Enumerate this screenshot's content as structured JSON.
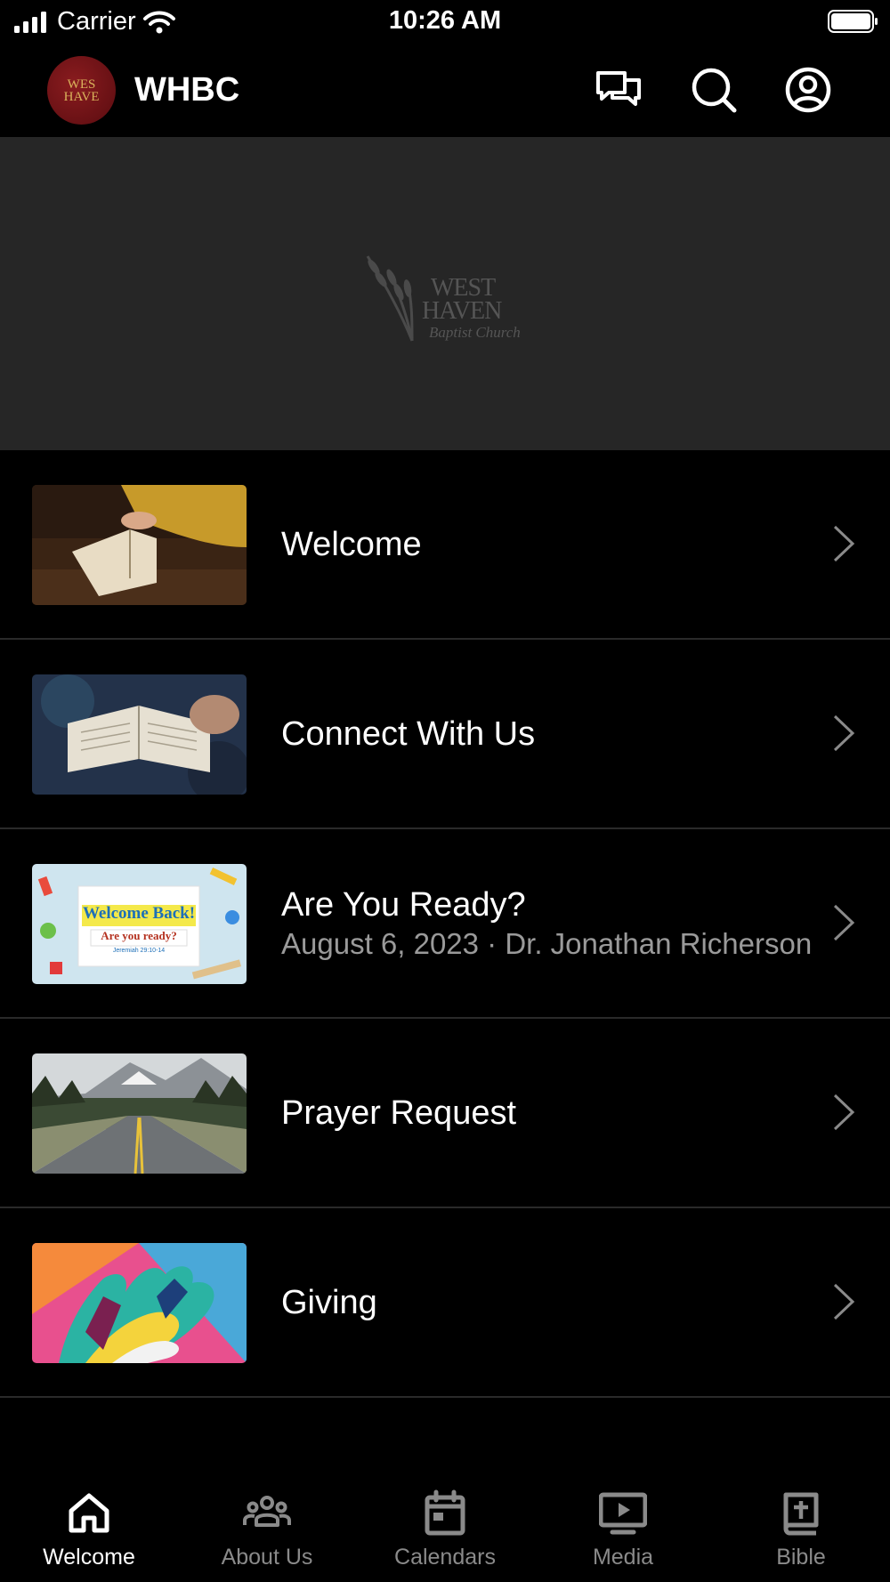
{
  "status_bar": {
    "carrier": "Carrier",
    "time": "10:26 AM"
  },
  "header": {
    "app_title": "WHBC",
    "logo_text": "WES\nHAVE"
  },
  "hero": {
    "logo_line1": "WEST",
    "logo_line2": "HAVEN",
    "logo_line3": "Baptist Church"
  },
  "items": [
    {
      "title": "Welcome",
      "subtitle": ""
    },
    {
      "title": "Connect With Us",
      "subtitle": ""
    },
    {
      "title": "Are You Ready?",
      "subtitle": "August 6, 2023 · Dr. Jonathan Richerson",
      "thumb_title": "Welcome Back!",
      "thumb_sub": "Are you ready?",
      "thumb_ref": "Jeremiah 29:10-14"
    },
    {
      "title": "Prayer Request",
      "subtitle": ""
    },
    {
      "title": "Giving",
      "subtitle": ""
    }
  ],
  "tabs": [
    {
      "label": "Welcome",
      "icon": "home-icon",
      "active": true
    },
    {
      "label": "About Us",
      "icon": "people-icon",
      "active": false
    },
    {
      "label": "Calendars",
      "icon": "calendar-icon",
      "active": false
    },
    {
      "label": "Media",
      "icon": "media-icon",
      "active": false
    },
    {
      "label": "Bible",
      "icon": "bible-icon",
      "active": false
    }
  ],
  "colors": {
    "background": "#000000",
    "hero_background": "#262626",
    "inactive_tab": "#8a8a8a",
    "logo_red": "#8a1c1f"
  }
}
